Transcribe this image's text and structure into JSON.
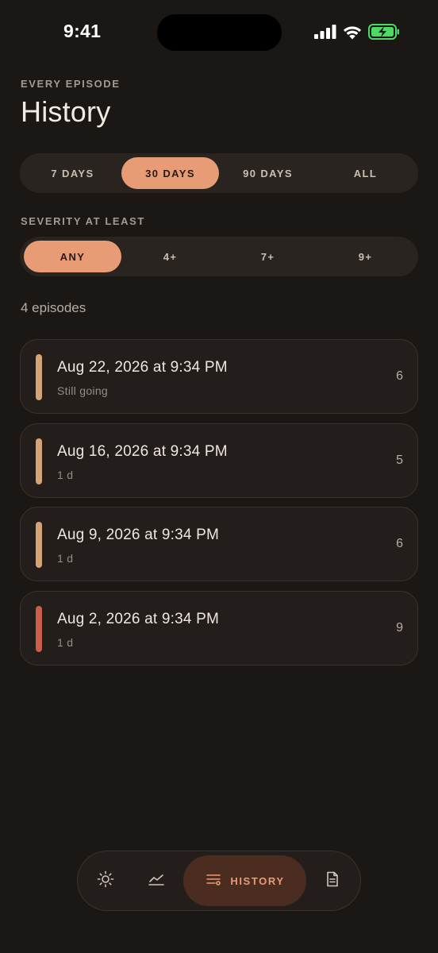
{
  "status_bar": {
    "time": "9:41"
  },
  "header": {
    "eyebrow": "EVERY EPISODE",
    "title": "History"
  },
  "range_filter": {
    "options": [
      "7 DAYS",
      "30 DAYS",
      "90 DAYS",
      "ALL"
    ],
    "selected": "30 DAYS"
  },
  "severity_filter": {
    "label": "SEVERITY AT LEAST",
    "options": [
      "ANY",
      "4+",
      "7+",
      "9+"
    ],
    "selected": "ANY"
  },
  "episode_count": "4 episodes",
  "episodes": [
    {
      "date": "Aug 22, 2026 at 9:34 PM",
      "duration": "Still going",
      "severity": "6",
      "color": "#d4a574"
    },
    {
      "date": "Aug 16, 2026 at 9:34 PM",
      "duration": "1 d",
      "severity": "5",
      "color": "#d4a574"
    },
    {
      "date": "Aug 9, 2026 at 9:34 PM",
      "duration": "1 d",
      "severity": "6",
      "color": "#d4a574"
    },
    {
      "date": "Aug 2, 2026 at 9:34 PM",
      "duration": "1 d",
      "severity": "9",
      "color": "#c95f4a"
    }
  ],
  "tab_bar": {
    "tabs": [
      {
        "icon": "sun-icon"
      },
      {
        "icon": "trend-line-icon"
      },
      {
        "icon": "list-filter-icon",
        "label": "HISTORY"
      },
      {
        "icon": "document-icon"
      }
    ],
    "active": "HISTORY"
  },
  "colors": {
    "accent": "#e79c76",
    "background": "#1b1714",
    "card": "#231e1b",
    "moderate": "#d4a574",
    "severe": "#c95f4a",
    "battery": "#4cd964"
  }
}
